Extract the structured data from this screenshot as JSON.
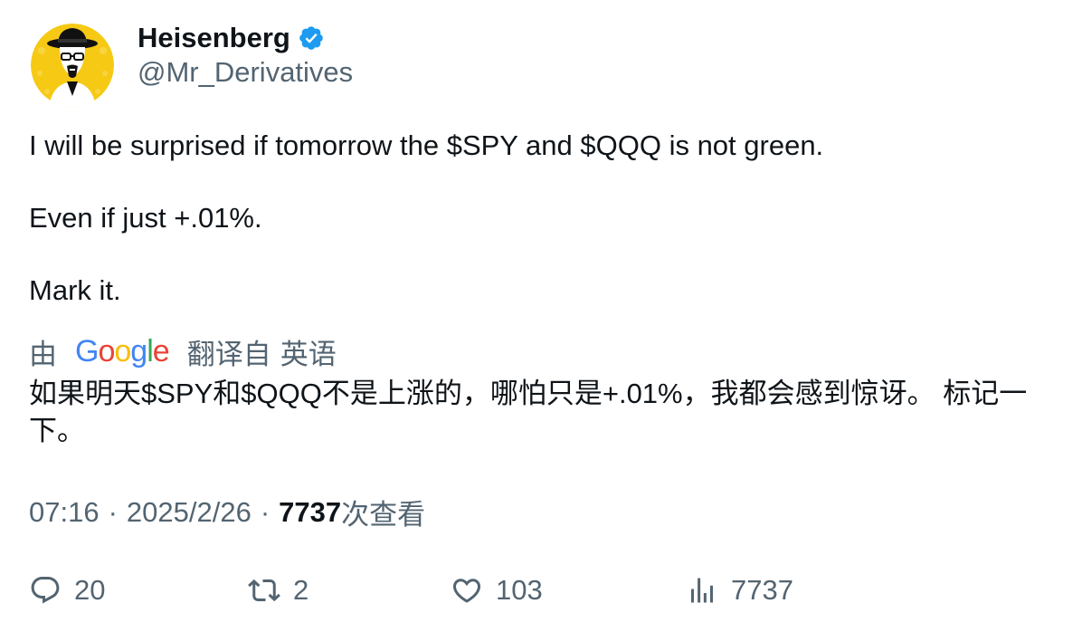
{
  "author": {
    "display_name": "Heisenberg",
    "handle": "@Mr_Derivatives",
    "verified_icon": "verified-badge-icon",
    "avatar_icon": "heisenberg-avatar"
  },
  "tweet": {
    "paragraphs": [
      "I will be surprised if tomorrow the $SPY and $QQQ is not green.",
      "Even if just +.01%.",
      "Mark it."
    ]
  },
  "translation": {
    "prefix": "由",
    "brand": "Google",
    "action": "翻译自",
    "source_language": "英语",
    "text": "如果明天$SPY和$QQQ不是上涨的，哪怕只是+.01%，我都会感到惊讶。 标记一下。"
  },
  "meta": {
    "time": "07:16",
    "separator": "·",
    "date": "2025/2/26",
    "views_count": "7737",
    "views_label": "次查看"
  },
  "actions": {
    "replies": "20",
    "retweets": "2",
    "likes": "103",
    "views": "7737"
  },
  "colors": {
    "text_primary": "#0f1419",
    "text_secondary": "#536471",
    "verified_blue": "#1d9bf0",
    "avatar_yellow": "#f6c915"
  }
}
